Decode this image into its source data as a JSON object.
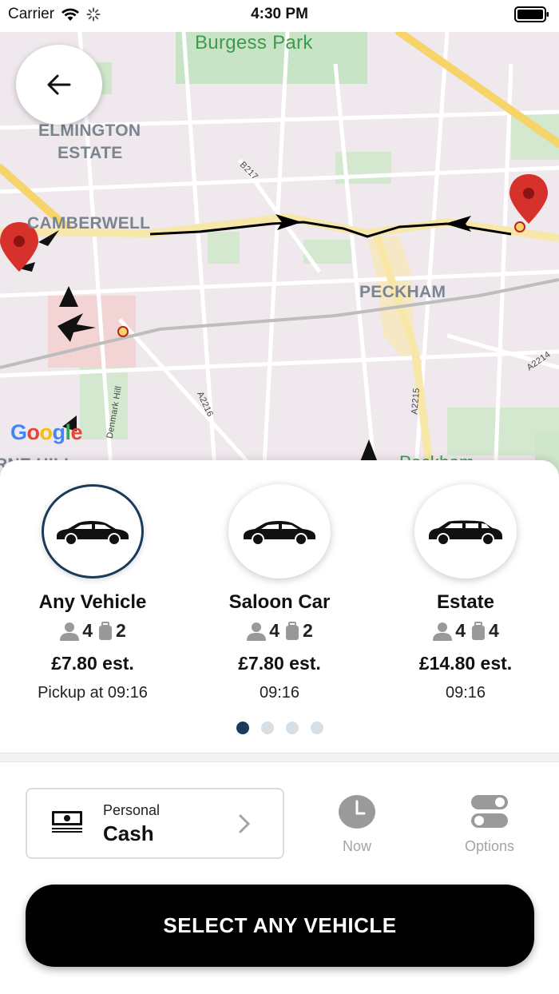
{
  "status_bar": {
    "carrier": "Carrier",
    "time": "4:30 PM"
  },
  "map": {
    "labels": {
      "park": "Burgess Park",
      "elmington": "ELMINGTON",
      "estate": "ESTATE",
      "camberwell": "CAMBERWELL",
      "peckham": "PECKHAM",
      "road_b217": "B217",
      "road_a2216": "A2216",
      "road_a2215": "A2215",
      "road_a2214": "A2214",
      "denmark_hill": "Denmark Hill",
      "bottom_left": "RNE HILL",
      "bottom_right": "Peckham"
    },
    "google_logo": {
      "g1": "G",
      "o1": "o",
      "o2": "o",
      "g2": "g",
      "l": "l",
      "e": "e"
    },
    "route_color": "#000000",
    "pin_color": "#d7312b"
  },
  "back_button": {
    "icon": "arrow-left-icon"
  },
  "vehicles": [
    {
      "name": "Any Vehicle",
      "passengers": "4",
      "luggage": "2",
      "price": "£7.80 est.",
      "pickup": "Pickup at 09:16",
      "selected": true
    },
    {
      "name": "Saloon Car",
      "passengers": "4",
      "luggage": "2",
      "price": "£7.80 est.",
      "pickup": "09:16",
      "selected": false
    },
    {
      "name": "Estate",
      "passengers": "4",
      "luggage": "4",
      "price": "£14.80 est.",
      "pickup": "09:16",
      "selected": false
    }
  ],
  "pagination": {
    "total": 4,
    "active": 1
  },
  "payment": {
    "type": "Personal",
    "method": "Cash",
    "icon": "cash-icon"
  },
  "actions": {
    "now": {
      "label": "Now",
      "icon": "clock-icon"
    },
    "options": {
      "label": "Options",
      "icon": "toggles-icon"
    }
  },
  "primary_button": {
    "label": "SELECT ANY VEHICLE"
  },
  "colors": {
    "accent": "#1b3a5c",
    "muted": "#a4a4a4",
    "button": "#000000"
  }
}
